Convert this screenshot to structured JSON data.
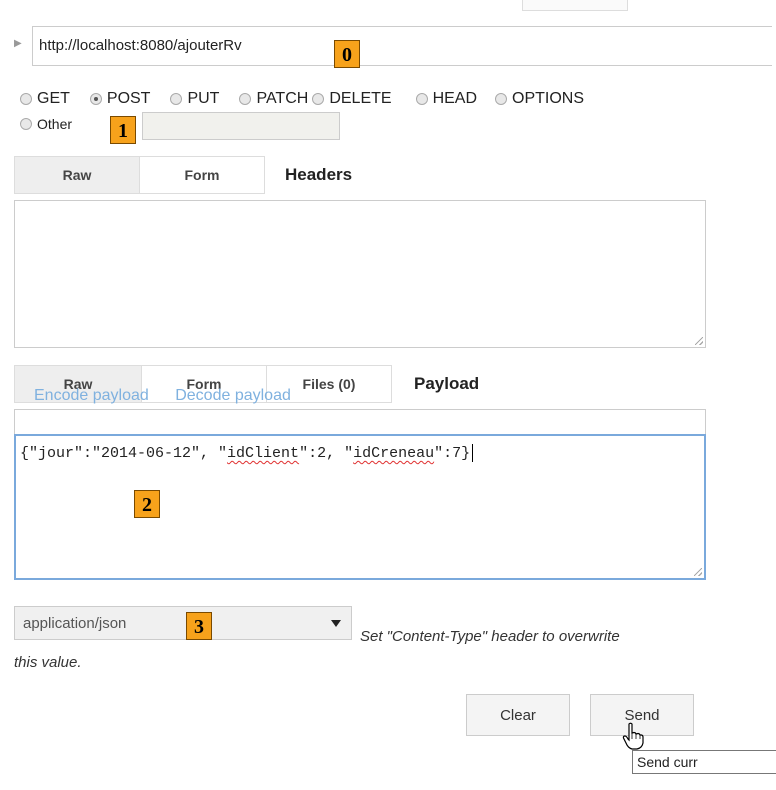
{
  "request": {
    "url": "http://localhost:8080/ajouterRv",
    "methods": [
      {
        "label": "GET",
        "selected": false
      },
      {
        "label": "POST",
        "selected": true
      },
      {
        "label": "PUT",
        "selected": false
      },
      {
        "label": "PATCH",
        "selected": false
      },
      {
        "label": "DELETE",
        "selected": false
      },
      {
        "label": "HEAD",
        "selected": false
      },
      {
        "label": "OPTIONS",
        "selected": false
      }
    ],
    "other_label": "Other",
    "other_value": ""
  },
  "headers": {
    "tab_raw": "Raw",
    "tab_form": "Form",
    "title": "Headers",
    "value": ""
  },
  "payload": {
    "tab_raw": "Raw",
    "tab_form": "Form",
    "tab_files": "Files (0)",
    "title": "Payload",
    "encode_label": "Encode payload",
    "decode_label": "Decode payload",
    "body_part1": "{\"jour\":\"2014-06-12\", \"",
    "body_word1": "idClient",
    "body_part2": "\":2, \"",
    "body_word2": "idCreneau",
    "body_part3": "\":7}"
  },
  "content_type": {
    "selected": "application/json",
    "hint_line1": "Set \"Content-Type\" header to overwrite",
    "hint_line2": "this value."
  },
  "actions": {
    "clear_label": "Clear",
    "send_label": "Send",
    "tooltip": "Send curr"
  },
  "annotations": [
    "0",
    "1",
    "2",
    "3"
  ],
  "colors": {
    "badge": "#f7a21b",
    "focus_border": "#7aa9dc",
    "link": "#7fb1df"
  }
}
